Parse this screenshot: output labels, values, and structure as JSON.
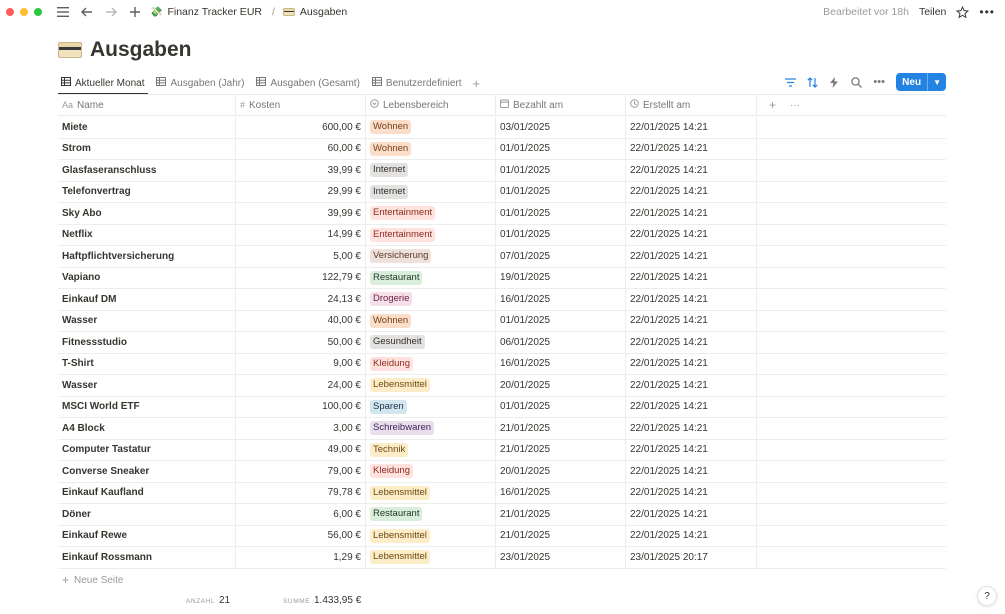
{
  "breadcrumb": {
    "workspace": "Finanz Tracker EUR",
    "page": "Ausgaben"
  },
  "topbar": {
    "edited": "Bearbeitet vor 18h",
    "share": "Teilen"
  },
  "page_title": "Ausgaben",
  "tabs": [
    {
      "label": "Aktueller Monat",
      "active": true
    },
    {
      "label": "Ausgaben (Jahr)",
      "active": false
    },
    {
      "label": "Ausgaben (Gesamt)",
      "active": false
    },
    {
      "label": "Benutzerdefiniert",
      "active": false
    }
  ],
  "new_button": "Neu",
  "columns": {
    "name": "Name",
    "cost": "Kosten",
    "area": "Lebensbereich",
    "paid": "Bezahlt am",
    "created": "Erstellt am"
  },
  "column_icons": {
    "name": "Aa",
    "cost": "#"
  },
  "tag_colors": {
    "Wohnen": {
      "bg": "#fadec9",
      "fg": "#7a3e14"
    },
    "Internet": {
      "bg": "#e3e2e0",
      "fg": "#32302c"
    },
    "Entertainment": {
      "bg": "#ffe2dd",
      "fg": "#8a2b22"
    },
    "Versicherung": {
      "bg": "#eee0da",
      "fg": "#5c3a2a"
    },
    "Restaurant": {
      "bg": "#dbeddb",
      "fg": "#1c3829"
    },
    "Drogerie": {
      "bg": "#f5e0e9",
      "fg": "#6b2447"
    },
    "Gesundheit": {
      "bg": "#e3e2e0",
      "fg": "#32302c"
    },
    "Kleidung": {
      "bg": "#ffe2dd",
      "fg": "#8a2b22"
    },
    "Lebensmittel": {
      "bg": "#fdecc8",
      "fg": "#6b4a12"
    },
    "Sparen": {
      "bg": "#d3e5ef",
      "fg": "#183347"
    },
    "Schreibwaren": {
      "bg": "#e8deee",
      "fg": "#412454"
    },
    "Technik": {
      "bg": "#fdecc8",
      "fg": "#6b4a12"
    }
  },
  "rows": [
    {
      "name": "Miete",
      "cost": "600,00 €",
      "area": "Wohnen",
      "paid": "03/01/2025",
      "created": "22/01/2025 14:21"
    },
    {
      "name": "Strom",
      "cost": "60,00 €",
      "area": "Wohnen",
      "paid": "01/01/2025",
      "created": "22/01/2025 14:21"
    },
    {
      "name": "Glasfaseranschluss",
      "cost": "39,99 €",
      "area": "Internet",
      "paid": "01/01/2025",
      "created": "22/01/2025 14:21"
    },
    {
      "name": "Telefonvertrag",
      "cost": "29,99 €",
      "area": "Internet",
      "paid": "01/01/2025",
      "created": "22/01/2025 14:21"
    },
    {
      "name": "Sky Abo",
      "cost": "39,99 €",
      "area": "Entertainment",
      "paid": "01/01/2025",
      "created": "22/01/2025 14:21"
    },
    {
      "name": "Netflix",
      "cost": "14,99 €",
      "area": "Entertainment",
      "paid": "01/01/2025",
      "created": "22/01/2025 14:21"
    },
    {
      "name": "Haftpflichtversicherung",
      "cost": "5,00 €",
      "area": "Versicherung",
      "paid": "07/01/2025",
      "created": "22/01/2025 14:21"
    },
    {
      "name": "Vapiano",
      "cost": "122,79 €",
      "area": "Restaurant",
      "paid": "19/01/2025",
      "created": "22/01/2025 14:21"
    },
    {
      "name": "Einkauf DM",
      "cost": "24,13 €",
      "area": "Drogerie",
      "paid": "16/01/2025",
      "created": "22/01/2025 14:21"
    },
    {
      "name": "Wasser",
      "cost": "40,00 €",
      "area": "Wohnen",
      "paid": "01/01/2025",
      "created": "22/01/2025 14:21"
    },
    {
      "name": "Fitnessstudio",
      "cost": "50,00 €",
      "area": "Gesundheit",
      "paid": "06/01/2025",
      "created": "22/01/2025 14:21"
    },
    {
      "name": "T-Shirt",
      "cost": "9,00 €",
      "area": "Kleidung",
      "paid": "16/01/2025",
      "created": "22/01/2025 14:21"
    },
    {
      "name": "Wasser",
      "cost": "24,00 €",
      "area": "Lebensmittel",
      "paid": "20/01/2025",
      "created": "22/01/2025 14:21"
    },
    {
      "name": "MSCI World ETF",
      "cost": "100,00 €",
      "area": "Sparen",
      "paid": "01/01/2025",
      "created": "22/01/2025 14:21"
    },
    {
      "name": "A4 Block",
      "cost": "3,00 €",
      "area": "Schreibwaren",
      "paid": "21/01/2025",
      "created": "22/01/2025 14:21"
    },
    {
      "name": "Computer Tastatur",
      "cost": "49,00 €",
      "area": "Technik",
      "paid": "21/01/2025",
      "created": "22/01/2025 14:21"
    },
    {
      "name": "Converse Sneaker",
      "cost": "79,00 €",
      "area": "Kleidung",
      "paid": "20/01/2025",
      "created": "22/01/2025 14:21"
    },
    {
      "name": "Einkauf Kaufland",
      "cost": "79,78 €",
      "area": "Lebensmittel",
      "paid": "16/01/2025",
      "created": "22/01/2025 14:21"
    },
    {
      "name": "Döner",
      "cost": "6,00 €",
      "area": "Restaurant",
      "paid": "21/01/2025",
      "created": "22/01/2025 14:21"
    },
    {
      "name": "Einkauf Rewe",
      "cost": "56,00 €",
      "area": "Lebensmittel",
      "paid": "21/01/2025",
      "created": "22/01/2025 14:21"
    },
    {
      "name": "Einkauf Rossmann",
      "cost": "1,29 €",
      "area": "Lebensmittel",
      "paid": "23/01/2025",
      "created": "23/01/2025 20:17"
    }
  ],
  "new_page": "Neue Seite",
  "footer": {
    "count_label": "ANZAHL",
    "count": "21",
    "sum_label": "SUMME",
    "sum": "1.433,95 €"
  },
  "help_label": "?"
}
